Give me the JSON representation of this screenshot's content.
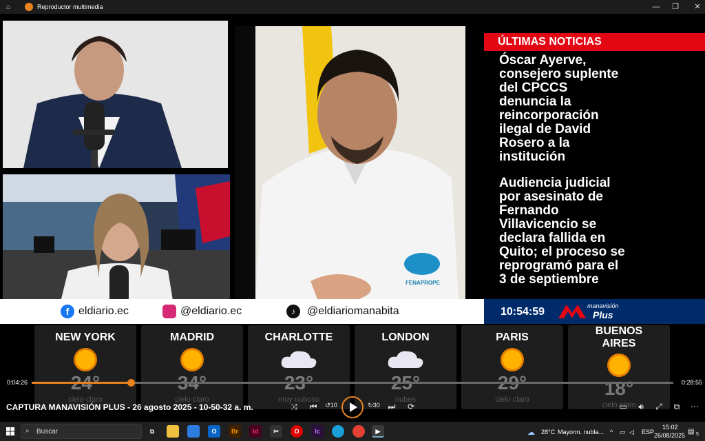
{
  "window": {
    "title": "Reproductor multimedia",
    "minimize": "—",
    "maximize": "❐",
    "close": "✕"
  },
  "news": {
    "header": "ÚLTIMAS NOTICIAS",
    "headline1": [
      "Óscar Ayerve,",
      "consejero suplente",
      "del CPCCS",
      "denuncia la",
      "reincorporación",
      "ilegal de David",
      "Rosero a la",
      "institución"
    ],
    "headline2": [
      "Audiencia judicial",
      "por asesinato de",
      "Fernando",
      "Villavicencio se",
      "declara fallida en",
      "Quito; el proceso se",
      "reprogramó para el",
      "3 de septiembre"
    ],
    "clock": "10:54:59",
    "brand_top": "manavisión",
    "brand_bottom": "Plus"
  },
  "social": {
    "facebook": "eldiario.ec",
    "instagram": "@eldiario.ec",
    "tiktok": "@eldiariomanabita"
  },
  "scene": {
    "shirt_logo": "FENAPROPE"
  },
  "weather": [
    {
      "city": "NEW YORK",
      "temp": "24°",
      "desc": "cielo claro",
      "icon": "sun-icon"
    },
    {
      "city": "MADRID",
      "temp": "34°",
      "desc": "cielo claro",
      "icon": "sun-icon"
    },
    {
      "city": "CHARLOTTE",
      "temp": "23°",
      "desc": "muy nuboso",
      "icon": "cloud-icon"
    },
    {
      "city": "LONDON",
      "temp": "25°",
      "desc": "nubes",
      "icon": "cloud-icon"
    },
    {
      "city": "PARIS",
      "temp": "29°",
      "desc": "cielo claro",
      "icon": "sun-icon"
    },
    {
      "city": "BUENOS AIRES",
      "city_line1": "BUENOS",
      "city_line2": "AIRES",
      "temp": "18°",
      "desc": "cielo claro",
      "icon": "sun-icon"
    }
  ],
  "player": {
    "current_time": "0:04:26",
    "total_time": "0:28:55",
    "progress": 0.154,
    "media_title": "CAPTURA MANAVISIÓN PLUS - 26 agosto 2025 - 10-50-32 a. m.",
    "skip_back_label": "10",
    "skip_forward_label": "30"
  },
  "taskbar": {
    "search_placeholder": "Buscar",
    "weather": "28°C",
    "weather_desc": "Mayorm. nubla...",
    "lang": "ESP",
    "time": "15:02",
    "date": "26/08/2025",
    "notif_count": "5"
  },
  "colors": {
    "accent": "#e8831e",
    "news_red": "#e30613",
    "news_blue": "#002b6b"
  }
}
